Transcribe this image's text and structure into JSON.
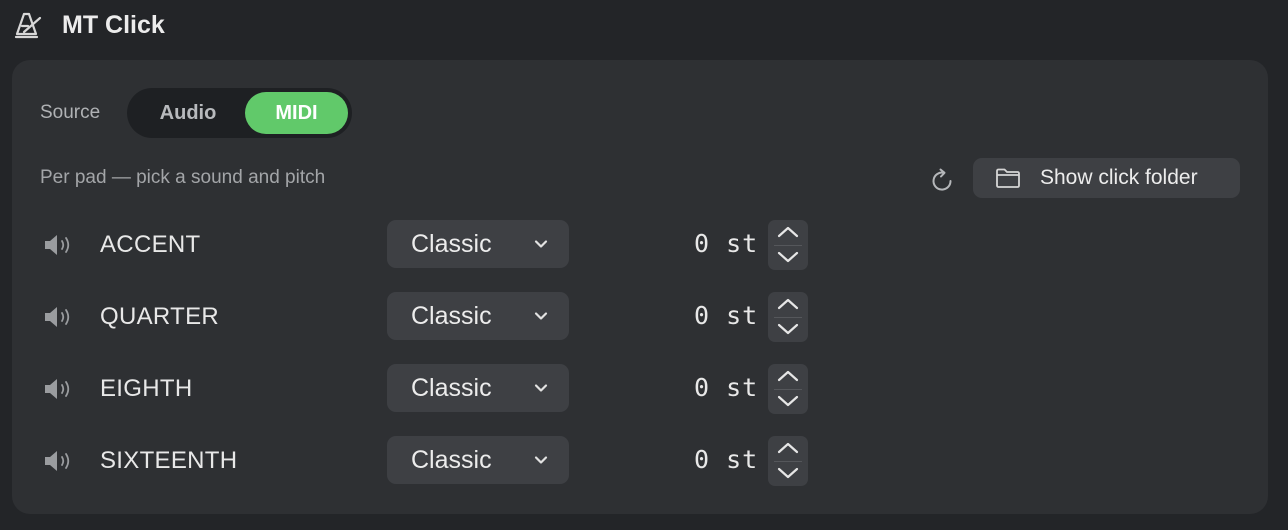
{
  "header": {
    "title": "MT Click",
    "icon": "metronome-icon"
  },
  "source": {
    "label": "Source",
    "options": [
      "Audio",
      "MIDI"
    ],
    "selected": "MIDI",
    "accent_color": "#61c96a"
  },
  "hint": "Per pad — pick a sound and pitch",
  "toolbar": {
    "refresh_icon": "refresh-icon",
    "folder_button_label": "Show click folder",
    "folder_icon": "folder-icon"
  },
  "pads": [
    {
      "name": "ACCENT",
      "sound": "Classic",
      "pitch": "0 st"
    },
    {
      "name": "QUARTER",
      "sound": "Classic",
      "pitch": "0 st"
    },
    {
      "name": "EIGHTH",
      "sound": "Classic",
      "pitch": "0 st"
    },
    {
      "name": "SIXTEENTH",
      "sound": "Classic",
      "pitch": "0 st"
    }
  ]
}
